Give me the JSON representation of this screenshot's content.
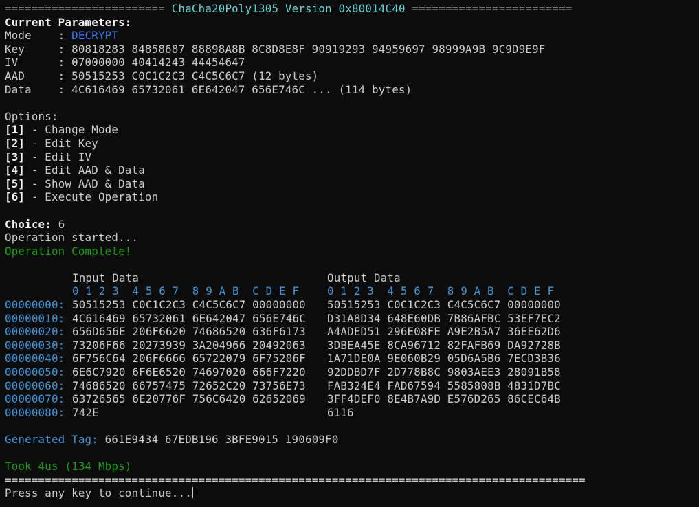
{
  "header": {
    "rule_left": "========================",
    "title": "ChaCha20Poly1305 Version 0x80014C40",
    "rule_right": "========================"
  },
  "params": {
    "heading": "Current Parameters:",
    "mode_label": "Mode    : ",
    "mode_value": "DECRYPT",
    "key_line": "Key     : 80818283 84858687 88898A8B 8C8D8E8F 90919293 94959697 98999A9B 9C9D9E9F",
    "iv_line": "IV      : 07000000 40414243 44454647",
    "aad_line": "AAD     : 50515253 C0C1C2C3 C4C5C6C7 (12 bytes)",
    "data_line": "Data    : 4C616469 65732061 6E642047 656E746C ... (114 bytes)"
  },
  "options": {
    "heading": "Options:",
    "items": [
      {
        "key": "[1]",
        "label": " - Change Mode"
      },
      {
        "key": "[2]",
        "label": " - Edit Key"
      },
      {
        "key": "[3]",
        "label": " - Edit IV"
      },
      {
        "key": "[4]",
        "label": " - Edit AAD & Data"
      },
      {
        "key": "[5]",
        "label": " - Show AAD & Data"
      },
      {
        "key": "[6]",
        "label": " - Execute Operation"
      }
    ]
  },
  "choice": {
    "label": "Choice:",
    "value": " 6",
    "started": "Operation started...",
    "complete": "Operation Complete!"
  },
  "hex": {
    "input_title": "Input Data",
    "output_title": "Output Data",
    "column_header": "0 1 2 3  4 5 6 7  8 9 A B  C D E F",
    "rows": [
      {
        "addr": "00000000:",
        "in": "50515253 C0C1C2C3 C4C5C6C7 00000000",
        "out": "50515253 C0C1C2C3 C4C5C6C7 00000000"
      },
      {
        "addr": "00000010:",
        "in": "4C616469 65732061 6E642047 656E746C",
        "out": "D31A8D34 648E60DB 7B86AFBC 53EF7EC2"
      },
      {
        "addr": "00000020:",
        "in": "656D656E 206F6620 74686520 636F6173",
        "out": "A4ADED51 296E08FE A9E2B5A7 36EE62D6"
      },
      {
        "addr": "00000030:",
        "in": "73206F66 20273939 3A204966 20492063",
        "out": "3DBEA45E 8CA96712 82FAFB69 DA92728B"
      },
      {
        "addr": "00000040:",
        "in": "6F756C64 206F6666 65722079 6F75206F",
        "out": "1A71DE0A 9E060B29 05D6A5B6 7ECD3B36"
      },
      {
        "addr": "00000050:",
        "in": "6E6C7920 6F6E6520 74697020 666F7220",
        "out": "92DDBD7F 2D778B8C 9803AEE3 28091B58"
      },
      {
        "addr": "00000060:",
        "in": "74686520 66757475 72652C20 73756E73",
        "out": "FAB324E4 FAD67594 5585808B 4831D7BC"
      },
      {
        "addr": "00000070:",
        "in": "63726565 6E20776F 756C6420 62652069",
        "out": "3FF4DEF0 8E4B7A9D E576D265 86CEC64B"
      },
      {
        "addr": "00000080:",
        "in": "742E",
        "out": "6116"
      }
    ]
  },
  "tag": {
    "label": "Generated Tag:",
    "value": " 661E9434 67EDB196 3BFE9015 190609F0"
  },
  "timing": "Took 4us (134 Mbps)",
  "footer": {
    "rule": "=======================================================================================",
    "prompt": "Press any key to continue..."
  },
  "colors": {
    "background": "#0c0c0c",
    "text": "#cccccc",
    "title_cyan": "#61d6d6",
    "mode_blue": "#3b78ff",
    "label_light_blue": "#3a96dd",
    "success_green": "#13a10e"
  }
}
